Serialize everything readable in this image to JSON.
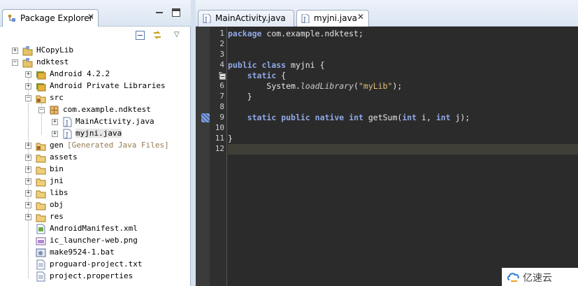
{
  "package_explorer": {
    "title": "Package Explorer",
    "close_glyph": "✕",
    "menu_glyph": "▽",
    "tree": [
      {
        "id": "hcopylib",
        "label": "HCopyLib",
        "icon": "project-icon"
      },
      {
        "id": "ndktest",
        "label": "ndktest",
        "icon": "project-icon"
      },
      {
        "id": "android422",
        "label": "Android 4.2.2",
        "icon": "library-icon"
      },
      {
        "id": "android-private",
        "label": "Android Private Libraries",
        "icon": "library-icon"
      },
      {
        "id": "src",
        "label": "src",
        "icon": "source-folder-icon"
      },
      {
        "id": "package",
        "label": "com.example.ndktest",
        "icon": "package-icon"
      },
      {
        "id": "mainactivity",
        "label": "MainActivity.java",
        "icon": "java-file-icon"
      },
      {
        "id": "myjni",
        "label": "myjni.java",
        "icon": "java-file-icon"
      },
      {
        "id": "gen",
        "label": "gen",
        "decoration": "[Generated Java Files]",
        "icon": "source-folder-icon"
      },
      {
        "id": "assets",
        "label": "assets",
        "icon": "folder-icon"
      },
      {
        "id": "bin",
        "label": "bin",
        "icon": "folder-icon"
      },
      {
        "id": "jni",
        "label": "jni",
        "icon": "folder-icon"
      },
      {
        "id": "libs",
        "label": "libs",
        "icon": "folder-icon"
      },
      {
        "id": "obj",
        "label": "obj",
        "icon": "folder-icon"
      },
      {
        "id": "res",
        "label": "res",
        "icon": "folder-icon"
      },
      {
        "id": "manifest",
        "label": "AndroidManifest.xml",
        "icon": "xml-file-icon"
      },
      {
        "id": "ic-launcher",
        "label": "ic_launcher-web.png",
        "icon": "image-file-icon"
      },
      {
        "id": "make-bat",
        "label": "make9524-1.bat",
        "icon": "bat-file-icon"
      },
      {
        "id": "proguard",
        "label": "proguard-project.txt",
        "icon": "text-file-icon"
      },
      {
        "id": "project-props",
        "label": "project.properties",
        "icon": "text-file-icon"
      }
    ]
  },
  "editor": {
    "tabs": [
      {
        "label": "MainActivity.java",
        "active": false
      },
      {
        "label": "myjni.java",
        "active": true,
        "close_glyph": "✕"
      }
    ],
    "line_numbers": [
      "1",
      "2",
      "3",
      "4",
      "5",
      "6",
      "7",
      "8",
      "9",
      "10",
      "11",
      "12"
    ],
    "code": {
      "l1_kw": "package",
      "l1_rest": " com.example.ndktest;",
      "l4_kw1": "public",
      "l4_kw2": "class",
      "l4_rest": " myjni {",
      "l5_kw": "static",
      "l5_rest": " {",
      "l6_pre": "System.",
      "l6_method": "loadLibrary",
      "l6_open": "(",
      "l6_str": "\"myLib\"",
      "l6_close": ");",
      "l7": "}",
      "l9_kw1": "static",
      "l9_kw2": "public",
      "l9_kw3": "native",
      "l9_kw4": "int",
      "l9_name": " getSum(",
      "l9_kw5": "int",
      "l9_p1": " i, ",
      "l9_kw6": "int",
      "l9_p2": " j);",
      "l11": "}"
    },
    "colors": {
      "background": "#2b2b2b",
      "keyword": "#8fa9e6",
      "string": "#e2c07a",
      "current_line": "#3f3f37"
    }
  },
  "watermark": {
    "label": "亿速云"
  }
}
